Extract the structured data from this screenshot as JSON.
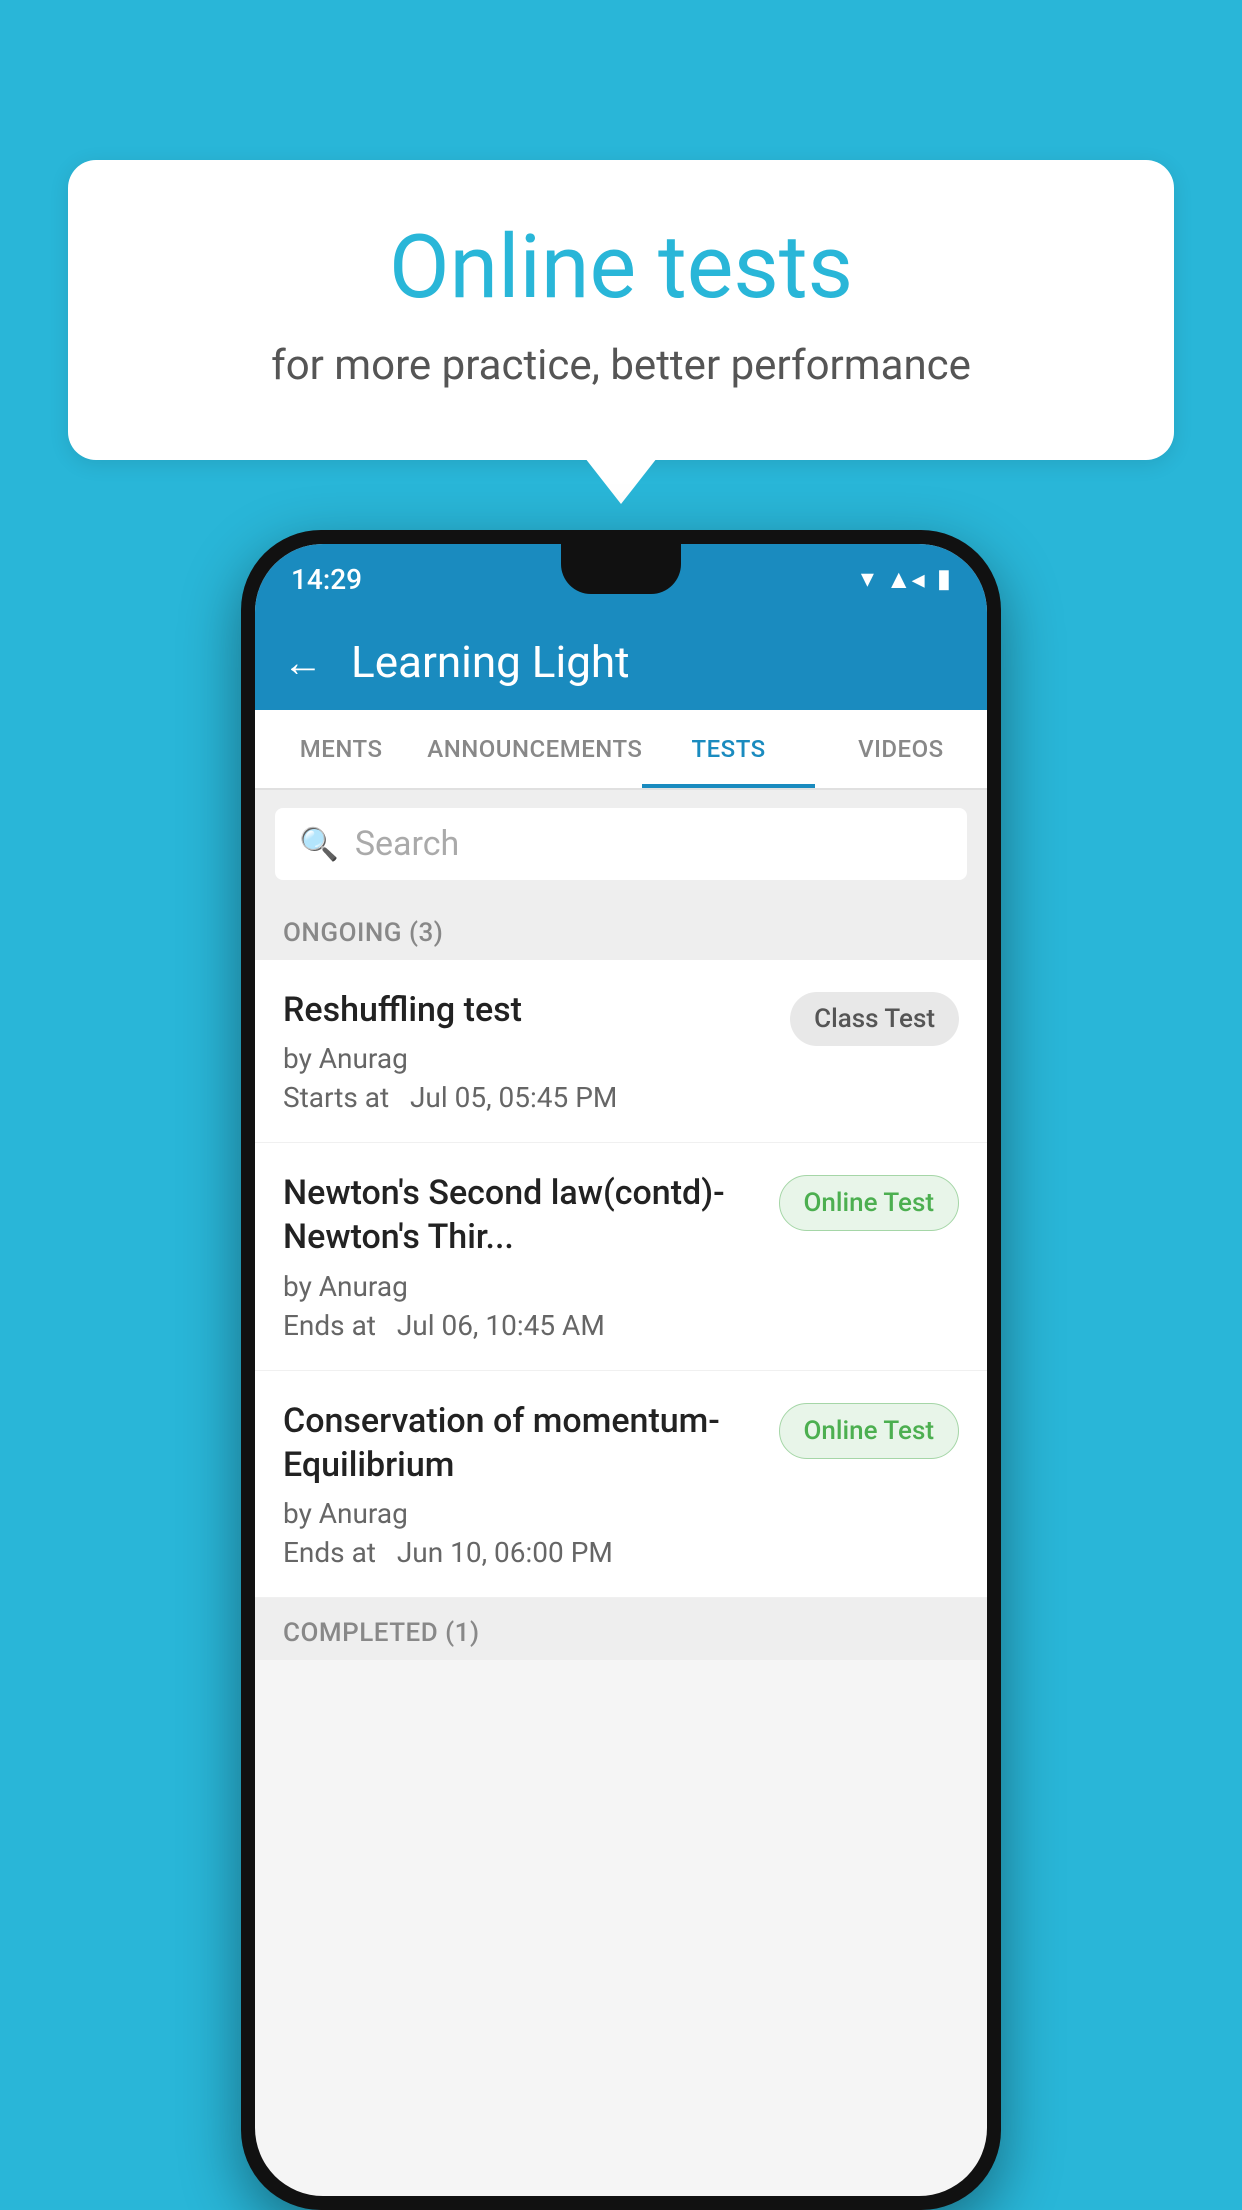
{
  "background": {
    "color": "#29b6d8"
  },
  "bubble": {
    "title": "Online tests",
    "subtitle": "for more practice, better performance"
  },
  "phone": {
    "status_bar": {
      "time": "14:29"
    },
    "app_bar": {
      "title": "Learning Light",
      "back_label": "←"
    },
    "tabs": [
      {
        "label": "MENTS",
        "active": false
      },
      {
        "label": "ANNOUNCEMENTS",
        "active": false
      },
      {
        "label": "TESTS",
        "active": true
      },
      {
        "label": "VIDEOS",
        "active": false
      }
    ],
    "search": {
      "placeholder": "Search"
    },
    "ongoing_section": {
      "label": "ONGOING (3)"
    },
    "test_items": [
      {
        "name": "Reshuffling test",
        "by": "by Anurag",
        "time_label": "Starts at",
        "time": "Jul 05, 05:45 PM",
        "badge": "Class Test",
        "badge_type": "class"
      },
      {
        "name": "Newton's Second law(contd)-Newton's Thir...",
        "by": "by Anurag",
        "time_label": "Ends at",
        "time": "Jul 06, 10:45 AM",
        "badge": "Online Test",
        "badge_type": "online"
      },
      {
        "name": "Conservation of momentum-Equilibrium",
        "by": "by Anurag",
        "time_label": "Ends at",
        "time": "Jun 10, 06:00 PM",
        "badge": "Online Test",
        "badge_type": "online"
      }
    ],
    "completed_section": {
      "label": "COMPLETED (1)"
    }
  }
}
